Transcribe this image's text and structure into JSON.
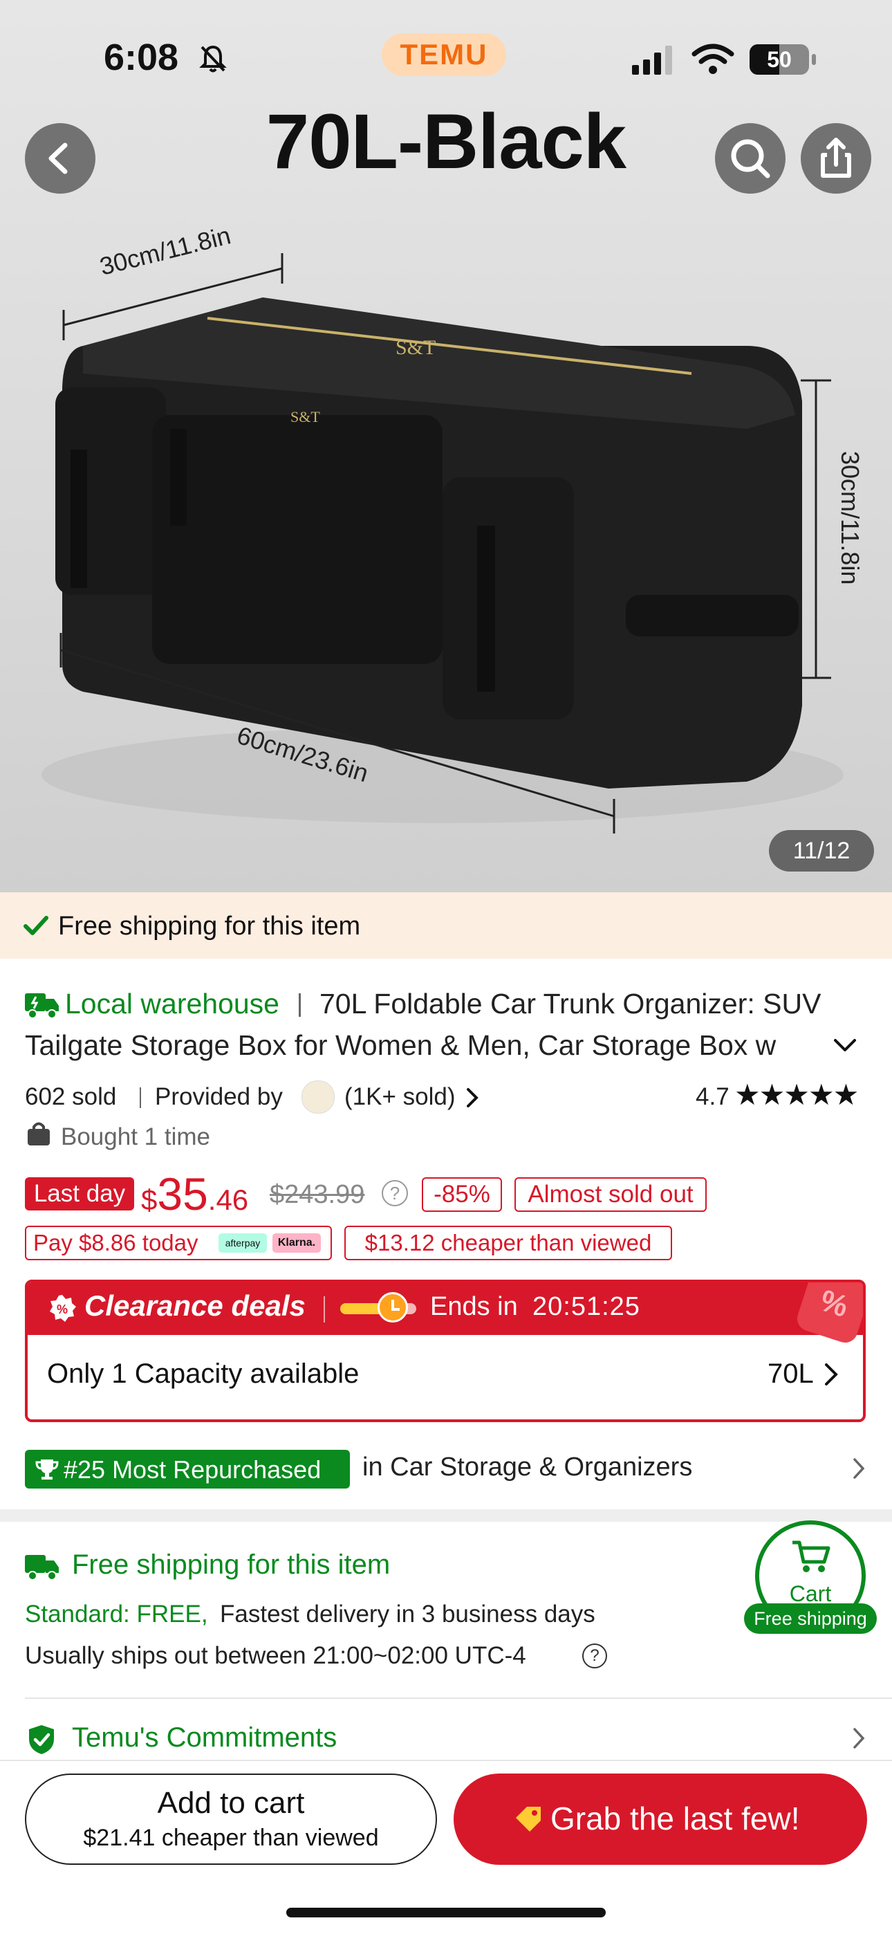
{
  "status_bar": {
    "time": "6:08",
    "app_logo": "TEMU",
    "battery": "50"
  },
  "hero": {
    "title": "70L-Black",
    "dim_width": "30cm/11.8in",
    "dim_height": "30cm/11.8in",
    "dim_length": "60cm/23.6in",
    "brand": "S&T",
    "page_counter": "11/12"
  },
  "shipping_banner": {
    "text": "Free shipping for this item"
  },
  "product": {
    "warehouse_label": "Local warehouse",
    "title_line1": "70L Foldable Car Trunk Organizer: SUV",
    "title_line2": "Tailgate Storage Box for Women & Men, Car Storage Box w",
    "sold": "602 sold",
    "provided_by": "Provided by",
    "store_sold": "(1K+ sold)",
    "rating": "4.7",
    "bought": "Bought 1 time"
  },
  "price": {
    "last_day": "Last day",
    "currency": "$",
    "main": "35",
    "cents": ".46",
    "original": "$243.99",
    "discount": "-85%",
    "stock": "Almost sold out",
    "pay_today": "Pay $8.86 today",
    "afterpay": "afterpay",
    "klarna": "Klarna.",
    "cheaper": "$13.12 cheaper than viewed"
  },
  "clearance": {
    "title": "Clearance deals",
    "ends_label": "Ends in",
    "countdown": "20:51:25",
    "percent_icon_text": "%",
    "only_text": "Only 1 Capacity available",
    "capacity": "70L"
  },
  "ranking": {
    "badge": "#25 Most Repurchased",
    "category": "in Car Storage & Organizers"
  },
  "shipping": {
    "title": "Free shipping for this item",
    "standard": "Standard: FREE,",
    "fastest": "Fastest delivery in 3 business days",
    "ships": "Usually ships out between 21:00~02:00 UTC-4"
  },
  "cart_float": {
    "label": "Cart",
    "note": "Free shipping"
  },
  "commitments": {
    "label": "Temu's Commitments"
  },
  "bottom": {
    "add_to_cart": "Add to cart",
    "add_sub": "$21.41 cheaper than viewed",
    "grab": "Grab the last few!"
  },
  "colors": {
    "accent_red": "#d7182a",
    "green": "#0a8a1f",
    "temu_orange": "#f26b0f"
  }
}
